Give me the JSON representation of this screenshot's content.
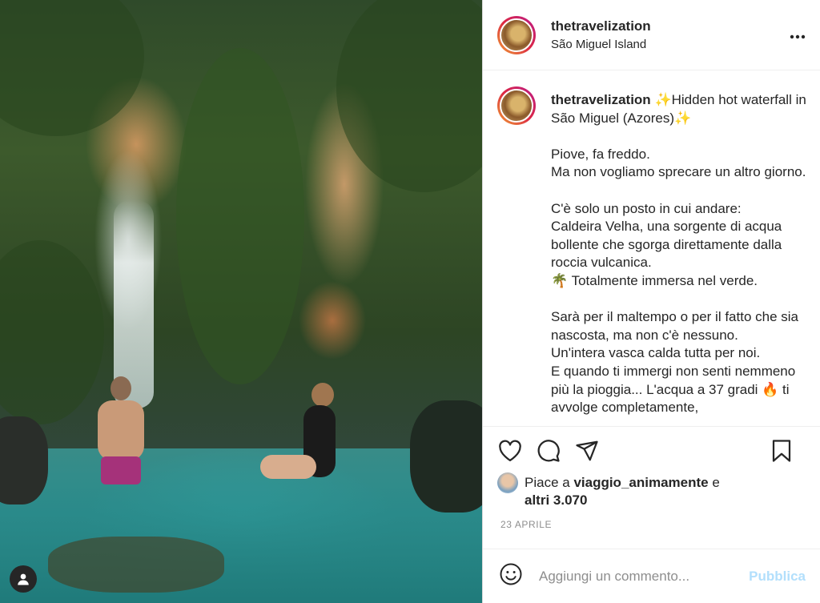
{
  "post": {
    "username": "thetravelization",
    "location": "São Miguel Island",
    "more_icon": "more-horizontal-icon",
    "caption": {
      "username": "thetravelization",
      "title": "✨Hidden hot waterfall in São Miguel (Azores)✨",
      "paragraphs": [
        [
          "Piove, fa freddo.",
          "Ma non vogliamo sprecare un altro giorno."
        ],
        [
          "C'è solo un posto in cui andare:",
          "Caldeira Velha, una sorgente di acqua bollente che sgorga direttamente dalla roccia vulcanica.",
          "🌴 Totalmente immersa nel verde."
        ],
        [
          "Sarà per il maltempo o per il fatto che sia nascosta, ma non c'è nessuno.",
          "Un'intera vasca calda tutta per noi.",
          "E quando ti immergi non senti nemmeno più la pioggia... L'acqua a 37 gradi 🔥 ti avvolge completamente,"
        ]
      ]
    },
    "actions": {
      "like_icon": "heart-icon",
      "comment_icon": "comment-icon",
      "share_icon": "share-icon",
      "save_icon": "bookmark-icon"
    },
    "likes": {
      "prefix": "Piace a ",
      "user": "viaggio_animamente",
      "joiner": " e",
      "others": "altri 3.070"
    },
    "date": "23 APRILE",
    "comment": {
      "emoji_icon": "smiley-icon",
      "placeholder": "Aggiungi un commento...",
      "publish": "Pubblica"
    },
    "photo_user_tag_icon": "user-tag-icon"
  },
  "colors": {
    "text": "#262626",
    "muted": "#8e8e8e",
    "publish_disabled": "#b2dffc",
    "border": "#efefef"
  }
}
